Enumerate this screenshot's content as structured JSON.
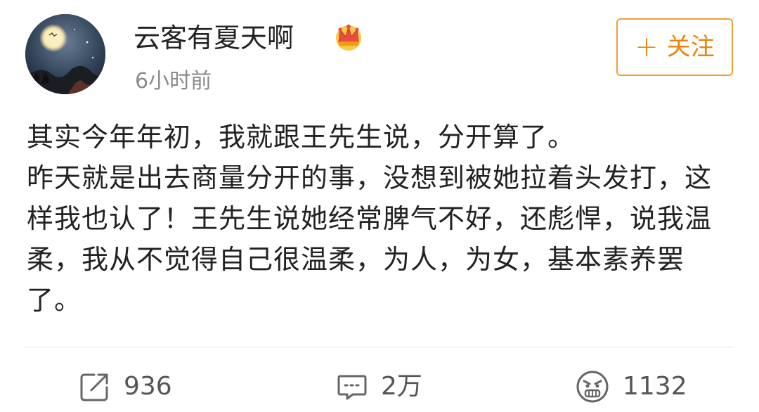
{
  "post": {
    "author": {
      "username": "云客有夏天啊",
      "badge_icon": "crown-icon",
      "avatar_icon": "moon-night-avatar"
    },
    "time": "6小时前",
    "follow_button": {
      "icon": "plus-icon",
      "plus": "+",
      "label": "关注"
    },
    "content_lines": [
      "其实今年年初，我就跟王先生说，分开算了。",
      "昨天就是出去商量分开的事，没想到被她拉着头发打，这样我也认了！王先生说她经常脾气不好，还彪悍，说我温柔，我从不觉得自己很温柔，为人，为女，基本素养罢了。"
    ],
    "actions": {
      "repost": {
        "icon": "repost-icon",
        "count": "936"
      },
      "comment": {
        "icon": "comment-icon",
        "count": "2万"
      },
      "like": {
        "icon": "angry-face-icon",
        "count": "1132"
      }
    }
  },
  "colors": {
    "accent": "#e8860c",
    "accent_border": "#f19e3b",
    "text_primary": "#222222",
    "text_secondary": "#8a8a8a",
    "divider": "#e5e5e5"
  }
}
